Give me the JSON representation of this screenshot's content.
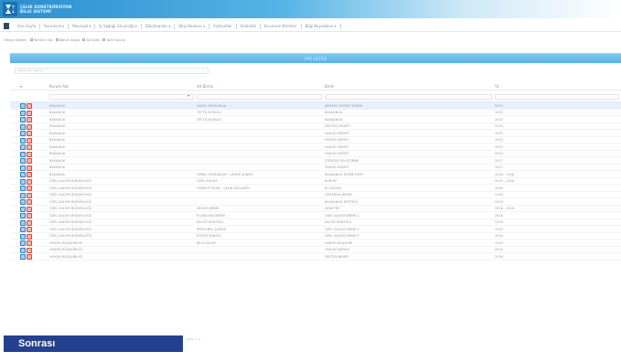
{
  "header": {
    "logo_line1": "ÇELİK KONSTRÜKSİYON",
    "logo_line2": "BİLGİ SİSTEMİ"
  },
  "menu": [
    {
      "label": "Ana Sayfa"
    },
    {
      "label": "Kurumsal ▾"
    },
    {
      "label": "Mevzuat ▾"
    },
    {
      "label": "İş Sağlığı Güvenliği ▾"
    },
    {
      "label": "Dökümanlar ▾"
    },
    {
      "label": "Bilgi Bankası ▾"
    },
    {
      "label": "Faaliyetler"
    },
    {
      "label": "İstatistik"
    },
    {
      "label": "Kurumsal Birimler"
    },
    {
      "label": "Bilgi Kaynakları ▾"
    }
  ],
  "filterbar": {
    "label": "Filtreyi Göster:",
    "options": [
      "Tümünü Seç",
      "Bölüm Sayısı",
      "Alt Birim",
      "Tarih Sınırla"
    ]
  },
  "titlebar": {
    "title": "YAPI LİSTESİ"
  },
  "search": {
    "placeholder": "Arama için yazınız..."
  },
  "table": {
    "columns": [
      "Kurum Adı",
      "Alt Birimi",
      "Birim",
      "Yıl"
    ],
    "rows": [
      [
        "BAKANLIK",
        "GENEL MÜDÜRLÜK",
        "MERKEZ HİZMET BİRİMİ",
        "2015"
      ],
      [
        "BAKANLIK",
        "TEFTİŞ KURULU",
        "BAŞKANLIK",
        "2015"
      ],
      [
        "BAKANLIK",
        "TEFTİŞ KURULU",
        "BAŞKANLIK",
        "2015"
      ],
      [
        "BAKANLIK",
        "",
        "DESTEK HİZMET",
        "2015"
      ],
      [
        "BAKANLIK",
        "",
        "HUKUK HİZMET",
        "2015"
      ],
      [
        "BAKANLIK",
        "",
        "HUKUK HİZMET",
        "2015"
      ],
      [
        "BAKANLIK",
        "",
        "HUKUK HİZMET",
        "2015"
      ],
      [
        "BAKANLIK",
        "",
        "HUKUK HİZMET",
        "2015"
      ],
      [
        "BAKANLIK",
        "",
        "STRATEJİ GELİŞTİRME",
        "2017"
      ],
      [
        "BAKANLIK",
        "",
        "HUKUK HİZMET",
        "2017"
      ],
      [
        "BAKANLIK",
        "GENEL MÜDÜRLÜK - ÇEVRE ŞUBESİ",
        "BAŞKANLIK HİZMETLERİ",
        "2016 - 2018"
      ],
      [
        "ÖZEL KALEM MÜDÜRLÜĞÜ",
        "ÖZEL KALEM",
        "KURUM",
        "2016 - 2018"
      ],
      [
        "ÖZEL KALEM MÜDÜRLÜĞÜ",
        "TÜRKİYE ÇELİK - ÇELİK BAĞLANTI",
        "İŞ SAĞLIĞI",
        "2016"
      ],
      [
        "ÖZEL KALEM MÜDÜRLÜĞÜ",
        "",
        "GÜVENLİK BİRİMİ",
        "2018"
      ],
      [
        "ÖZEL KALEM MÜDÜRLÜĞÜ",
        "",
        "BAŞKANLIK DESTEĞİ",
        "2018"
      ],
      [
        "ÖZEL KALEM MÜDÜRLÜĞÜ",
        "DEĞER BİRİMİ",
        "DENETİM",
        "2016 - 2018"
      ],
      [
        "ÖZEL KALEM MÜDÜRLÜĞÜ",
        "PLANLAMA BİRİMİ",
        "ÖZEL KALEM BİRİMİ 1",
        "2016"
      ],
      [
        "ÖZEL KALEM MÜDÜRLÜĞÜ",
        "KALİTE KONTROL",
        "KALİTE KONTROL",
        "2016"
      ],
      [
        "ÖZEL KALEM MÜDÜRLÜĞÜ",
        "PERSONEL ŞUBESİ",
        "ÖZEL KALEM BİRİMİ 2",
        "2016"
      ],
      [
        "ÖZEL KALEM MÜDÜRLÜĞÜ",
        "EĞİTİM ŞUBESİ",
        "ÖZEL KALEM BİRİMİ 3",
        "2016"
      ],
      [
        "HUKUK MÜŞAVİRLİĞİ",
        "BİLGİ İŞLEM",
        "HUKUK MÜŞAVİRİ",
        "2016"
      ],
      [
        "HUKUK MÜŞAVİRLİĞİ",
        "",
        "HUKUK DAİRESİ",
        "2016"
      ],
      [
        "HUKUK MÜŞAVİRLİĞİ",
        "",
        "DESTEK BİRİMİ",
        "2016"
      ]
    ]
  },
  "footer": {
    "next_label": "Sonrası",
    "pager_text": "Sayfa 1 / 4"
  },
  "colors": {
    "brand": "#23418f",
    "header_blue": "#2a8fcf",
    "titlebar": "#56b3e6",
    "edit_icon": "#2d7fc6",
    "delete_icon": "#d9483b"
  }
}
